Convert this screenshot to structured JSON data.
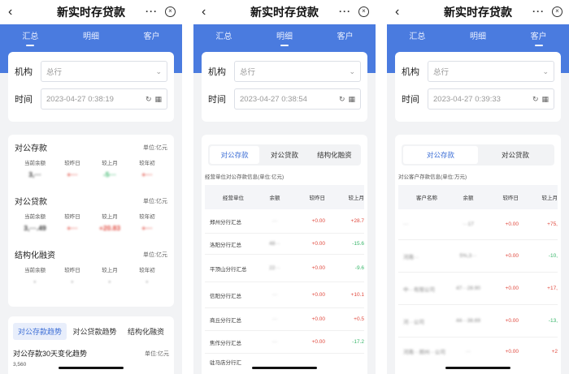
{
  "app": {
    "title": "新实时存贷款",
    "tabs": [
      "汇总",
      "明细",
      "客户"
    ]
  },
  "filter": {
    "org_label": "机构",
    "org_value": "总行",
    "time_label": "时间",
    "times": [
      "2023-04-27 0:38:19",
      "2023-04-27 0:38:54",
      "2023-04-27 0:39:33"
    ]
  },
  "summary": {
    "sections": [
      {
        "title": "对公存款",
        "unit": "单位:亿元",
        "headers": [
          "当前余额",
          "较昨日",
          "较上月",
          "较年初"
        ],
        "values": [
          "3,···",
          "+···",
          "-5···",
          "+···"
        ]
      },
      {
        "title": "对公贷款",
        "unit": "单位:亿元",
        "headers": [
          "当前余额",
          "较昨日",
          "较上月",
          "较年初"
        ],
        "values": [
          "3,···.49",
          "+···",
          "+20.83",
          "+···"
        ]
      },
      {
        "title": "结构化融资",
        "unit": "单位:亿元",
        "headers": [
          "当前余额",
          "较昨日",
          "较上月",
          "较年初"
        ],
        "values": [
          "·",
          "·",
          "·",
          "·"
        ]
      }
    ],
    "trend": {
      "tabs": [
        "对公存款趋势",
        "对公贷款趋势",
        "结构化融资"
      ],
      "label": "对公存款30天变化趋势",
      "unit": "单位:亿元",
      "axis_value": "3,560"
    }
  },
  "detail": {
    "segments": [
      "对公存款",
      "对公贷款",
      "结构化融资"
    ],
    "caption": "经营单位对公存款信息(单位:亿元)",
    "headers": [
      "经营单位",
      "余额",
      "较昨日",
      "较上月"
    ],
    "rows": [
      {
        "name": "郑州分行汇总",
        "bal": "···",
        "d": "+0.00",
        "m": "+28.7"
      },
      {
        "name": "洛阳分行汇总",
        "bal": "48···",
        "d": "+0.00",
        "m": "-15.6"
      },
      {
        "name": "平顶山分行汇总",
        "bal": "22···",
        "d": "+0.00",
        "m": "-9.6"
      },
      {
        "name": "信阳分行汇总",
        "bal": "···",
        "d": "+0.00",
        "m": "+10.1"
      },
      {
        "name": "商丘分行汇总",
        "bal": "···",
        "d": "+0.00",
        "m": "+0.5"
      },
      {
        "name": "焦作分行汇总",
        "bal": "···",
        "d": "+0.00",
        "m": "-17.2"
      },
      {
        "name": "驻马店分行汇",
        "bal": "",
        "d": "",
        "m": ""
      }
    ]
  },
  "customer": {
    "segments": [
      "对公存款",
      "对公贷款"
    ],
    "caption": "对公客户存款信息(单位:万元)",
    "headers": [
      "客户名称",
      "余额",
      "较昨日",
      "较上月"
    ],
    "rows": [
      {
        "name": "···",
        "bal": "···17",
        "d": "+0.00",
        "m": "+75,"
      },
      {
        "name": "河南···",
        "bal": "5%,3···",
        "d": "+0.00",
        "m": "-10,"
      },
      {
        "name": "中···有限公司",
        "bal": "47···28.90",
        "d": "+0.00",
        "m": "+17,"
      },
      {
        "name": "河···公司",
        "bal": "44···38.69",
        "d": "+0.00",
        "m": "-13,"
      },
      {
        "name": "河南···郑州···公司",
        "bal": "···",
        "d": "+0.00",
        "m": "+2"
      }
    ]
  }
}
